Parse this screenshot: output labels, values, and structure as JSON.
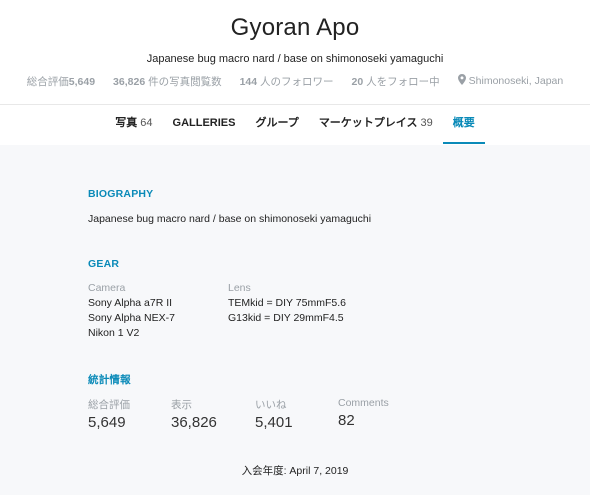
{
  "profile": {
    "name": "Gyoran Apo",
    "tagline": "Japanese bug macro nard / base on shimonoseki yamaguchi"
  },
  "stats": {
    "rating_label": "総合評価",
    "rating_value": "5,649",
    "views_value": "36,826",
    "views_label": " 件の写真閲覧数",
    "followers_value": "144",
    "followers_label": " 人のフォロワー",
    "following_value": "20",
    "following_label": " 人をフォロー中",
    "location": "Shimonoseki, Japan",
    "location_icon": "map-pin-icon"
  },
  "tabs": [
    {
      "label": "写真",
      "count": "64"
    },
    {
      "label": "GALLERIES",
      "count": ""
    },
    {
      "label": "グループ",
      "count": ""
    },
    {
      "label": "マーケットプレイス",
      "count": "39"
    },
    {
      "label": "概要",
      "count": ""
    }
  ],
  "biography": {
    "title": "BIOGRAPHY",
    "text": "Japanese bug macro nard / base on shimonoseki yamaguchi"
  },
  "gear": {
    "title": "GEAR",
    "camera_label": "Camera",
    "cameras": [
      "Sony Alpha a7R II",
      "Sony Alpha NEX-7",
      "Nikon 1 V2"
    ],
    "lens_label": "Lens",
    "lenses": [
      "TEMkid = DIY 75mmF5.6",
      "G13kid = DIY 29mmF4.5"
    ]
  },
  "statistics": {
    "title": "統計情報",
    "items": [
      {
        "label": "総合評価",
        "value": "5,649"
      },
      {
        "label": "表示",
        "value": "36,826"
      },
      {
        "label": "いいね",
        "value": "5,401"
      },
      {
        "label": "Comments",
        "value": "82"
      }
    ]
  },
  "joined": "入会年度: April 7, 2019",
  "colors": {
    "accent": "#0a8ab8",
    "muted": "#9aa0a6",
    "panel": "#f7f8fa"
  }
}
